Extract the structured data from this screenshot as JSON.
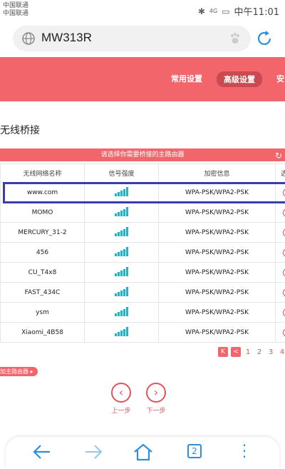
{
  "status_bar": {
    "carrier1": "中国联通",
    "carrier2": "中国联通",
    "time": "中午11:01",
    "signal_text": "4G"
  },
  "browser": {
    "url": "MW313R"
  },
  "router_nav": {
    "common_settings": "常用设置",
    "advanced_settings": "高级设置",
    "more": "安"
  },
  "page": {
    "title": "无线桥接"
  },
  "table": {
    "banner": "请选择你需要桥接的主路由器",
    "headers": {
      "name": "无线网络名称",
      "signal": "信号强度",
      "encryption": "加密信息",
      "select": "选择"
    },
    "rows": [
      {
        "name": "www.com",
        "encryption": "WPA-PSK/WPA2-PSK",
        "signal_level": 5
      },
      {
        "name": "MOMO",
        "encryption": "WPA-PSK/WPA2-PSK",
        "signal_level": 5
      },
      {
        "name": "MERCURY_31-2",
        "encryption": "WPA-PSK/WPA2-PSK",
        "signal_level": 5
      },
      {
        "name": "456",
        "encryption": "WPA-PSK/WPA2-PSK",
        "signal_level": 5
      },
      {
        "name": "CU_T4x8",
        "encryption": "WPA-PSK/WPA2-PSK",
        "signal_level": 5
      },
      {
        "name": "FAST_434C",
        "encryption": "WPA-PSK/WPA2-PSK",
        "signal_level": 5
      },
      {
        "name": "ysm",
        "encryption": "WPA-PSK/WPA2-PSK",
        "signal_level": 5
      },
      {
        "name": "Xiaomi_4B58",
        "encryption": "WPA-PSK/WPA2-PSK",
        "signal_level": 5
      }
    ]
  },
  "pager": {
    "first": "K",
    "prev": "<",
    "pages": [
      "1",
      "2",
      "3",
      "4"
    ],
    "next": ">"
  },
  "add_router": "加主路由器",
  "steps": {
    "prev_label": "上一步",
    "next_label": "下一步",
    "prev_glyph": "‹",
    "next_glyph": "›"
  },
  "bottom_bar": {
    "tabs_count": "2"
  },
  "colors": {
    "accent": "#f2656b",
    "highlight": "#3a3db0",
    "signal": "#1fb5c9"
  }
}
